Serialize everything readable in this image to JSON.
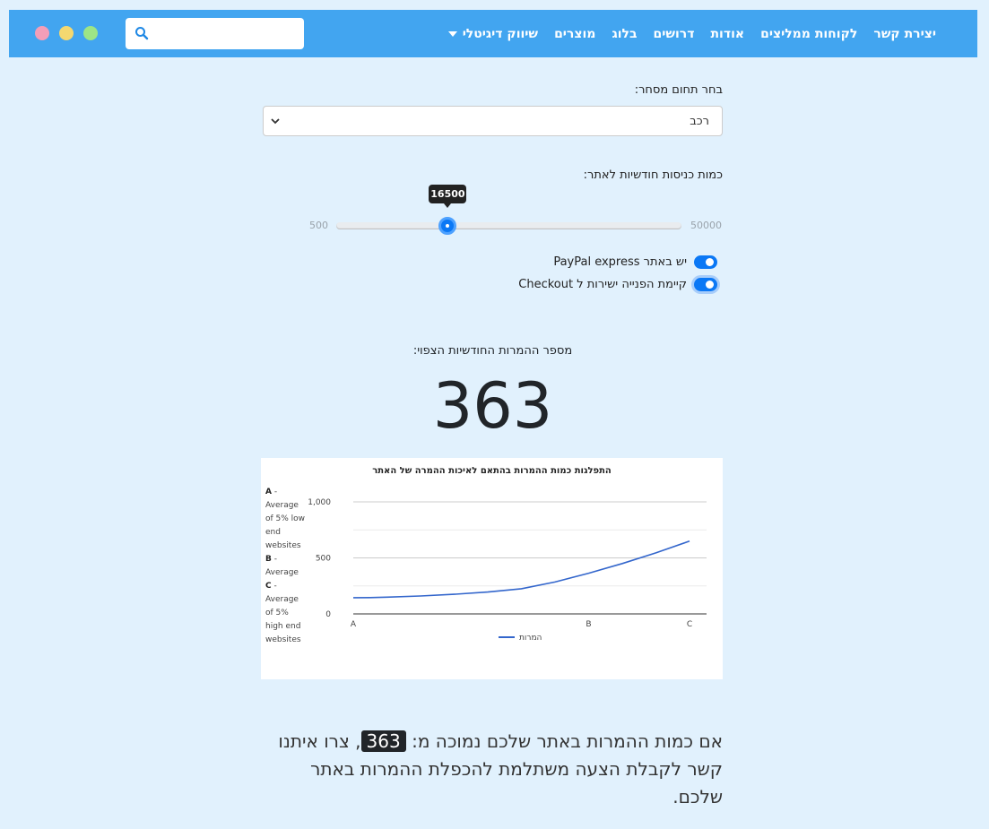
{
  "nav": {
    "items": [
      "שיווק דיגיטלי",
      "מוצרים",
      "בלוג",
      "דרושים",
      "אודות",
      "לקוחות ממליצים",
      "יצירת קשר"
    ],
    "search_placeholder": "",
    "window_dots": [
      "#f39eb8",
      "#f4d870",
      "#9de586"
    ]
  },
  "form": {
    "industry_label": "בחר תחום מסחר:",
    "industry_value": "רכב",
    "visits_label": "כמות כניסות חודשיות לאתר:",
    "slider_min": "500",
    "slider_max": "50000",
    "slider_value": "16500",
    "slider_level": 0.3232,
    "paypal_label": "יש באתר PayPal express",
    "checkout_label": "קיימת הפנייה ישירות ל Checkout"
  },
  "result": {
    "label": "מספר ההמרות החודשיות הצפוי:",
    "value": "363"
  },
  "chart_data": {
    "type": "line",
    "title": "התפלגות כמות ההמרות בהתאם לאיכות ההמרה של האתר",
    "categories": [
      "A",
      "B",
      "C"
    ],
    "x": [
      0,
      0.7,
      1
    ],
    "series": [
      {
        "name": "המרות",
        "color": "#3366cc",
        "values": [
          145,
          363,
          650
        ]
      }
    ],
    "curve_x": [
      0,
      0.05,
      0.1,
      0.2,
      0.3,
      0.4,
      0.5,
      0.6,
      0.7,
      0.8,
      0.9,
      1
    ],
    "curve_y": [
      145,
      146,
      150,
      160,
      175,
      195,
      225,
      285,
      363,
      450,
      545,
      650
    ],
    "ylim": [
      0,
      1000
    ],
    "yticks": [
      "0",
      "500",
      "1,000"
    ],
    "legend_position": "bottom",
    "side_legend": [
      {
        "key": "A",
        "text": "Average of 5% low end websites"
      },
      {
        "key": "B",
        "text": "Average"
      },
      {
        "key": "C",
        "text": "Average of 5% high end websites"
      }
    ]
  },
  "bottom": {
    "before": "אם כמות ההמרות באתר שלכם נמוכה מ:",
    "value": "363",
    "after": ", צרו איתנו קשר לקבלת הצעה משתלמת להכפלת ההמרות באתר שלכם."
  }
}
